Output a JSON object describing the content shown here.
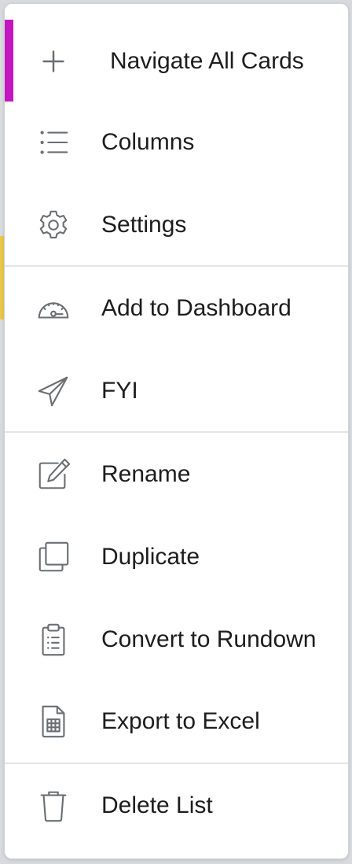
{
  "menu": {
    "items": [
      {
        "label": "Navigate All Cards",
        "icon": "plus-icon"
      },
      {
        "label": "Columns",
        "icon": "list-icon"
      },
      {
        "label": "Settings",
        "icon": "gear-icon"
      },
      {
        "label": "Add to Dashboard",
        "icon": "gauge-icon"
      },
      {
        "label": "FYI",
        "icon": "paper-plane-icon"
      },
      {
        "label": "Rename",
        "icon": "edit-icon"
      },
      {
        "label": "Duplicate",
        "icon": "copy-icon"
      },
      {
        "label": "Convert to Rundown",
        "icon": "clipboard-list-icon"
      },
      {
        "label": "Export to Excel",
        "icon": "spreadsheet-file-icon"
      },
      {
        "label": "Delete List",
        "icon": "trash-icon"
      }
    ],
    "active_index": 0
  },
  "colors": {
    "active_accent": "#c416c0",
    "text": "#1d1d1f",
    "icon": "#6b6e72",
    "divider": "#e3e5e8"
  }
}
